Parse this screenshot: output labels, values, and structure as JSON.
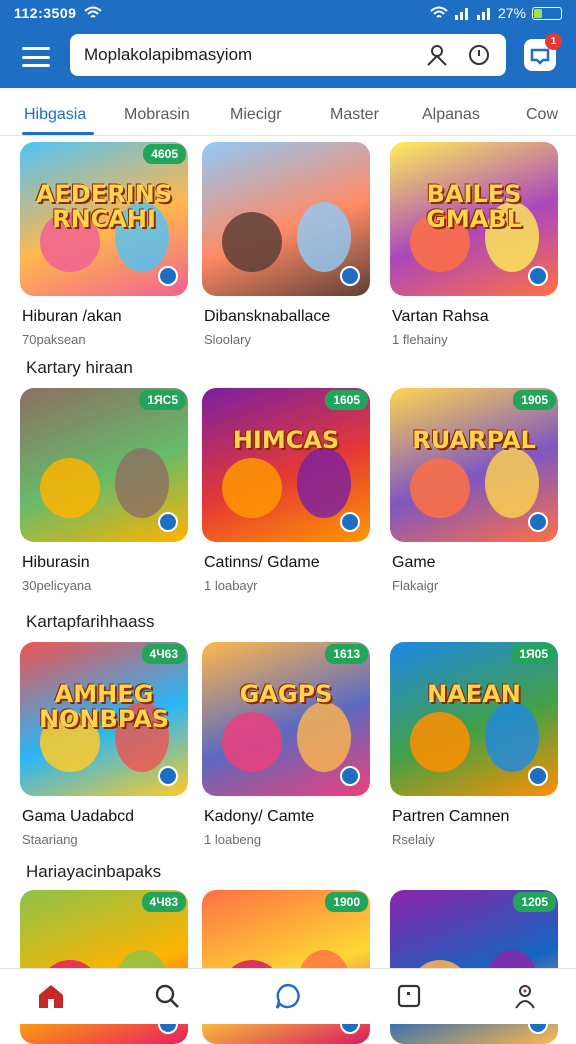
{
  "status": {
    "time": "112:3509",
    "battery": "27%",
    "battery_level": 0.27
  },
  "search": {
    "value": "Moplakolapibmasyiom"
  },
  "notifications": {
    "badge": "1"
  },
  "tabs": [
    {
      "label": "Hibgasia",
      "active": true
    },
    {
      "label": "Mobrasin",
      "active": false
    },
    {
      "label": "Miecigr",
      "active": false
    },
    {
      "label": "Master",
      "active": false
    },
    {
      "label": "Alpanas",
      "active": false
    },
    {
      "label": "Cow",
      "active": false
    }
  ],
  "sections": [
    {
      "title": "Kartary hiraan"
    },
    {
      "title": "Kartapfarihhaass"
    },
    {
      "title": "Hariayacinbapaks"
    }
  ],
  "cards": [
    {
      "name": "Hiburan /akan",
      "sub": "70paksean",
      "rating": "4605",
      "art": "AEDERINS\nRNCAHI"
    },
    {
      "name": "Dibansknaballace",
      "sub": "Sloolary",
      "rating": "",
      "art": ""
    },
    {
      "name": "Vartan Rahsa",
      "sub": "1 flehainy",
      "rating": "",
      "art": "BAILES\nGMABL"
    },
    {
      "name": "Hiburasin",
      "sub": "30pelicyana",
      "rating": "1ЯС5",
      "art": ""
    },
    {
      "name": "Catinns/ Gdame",
      "sub": "1 loabayr",
      "rating": "1605",
      "art": "HIMCAS"
    },
    {
      "name": "Game",
      "sub": "Flakaigr",
      "rating": "1905",
      "art": "RUARPAL"
    },
    {
      "name": "Gama Uadabcd",
      "sub": "Staariang",
      "rating": "4Ч63",
      "art": "AMHEG\nNONBPAS"
    },
    {
      "name": "Kadony/ Camte",
      "sub": "1 loabeng",
      "rating": "1613",
      "art": "GAGPS"
    },
    {
      "name": "Partren Camnen",
      "sub": "Rselaiy",
      "rating": "1Я05",
      "art": "NAEAN"
    },
    {
      "name": "",
      "sub": "",
      "rating": "4Ч83",
      "art": ""
    },
    {
      "name": "",
      "sub": "",
      "rating": "1900",
      "art": ""
    },
    {
      "name": "",
      "sub": "",
      "rating": "1205",
      "art": ""
    }
  ],
  "colors": {
    "brand": "#1e6fc4",
    "rating": "#22a55a",
    "home_active": "#c62828"
  },
  "icons": [
    "menu-icon",
    "user-icon",
    "clock-icon",
    "notification-icon",
    "home-icon",
    "search-icon",
    "chat-icon",
    "square-icon",
    "profile-icon"
  ]
}
